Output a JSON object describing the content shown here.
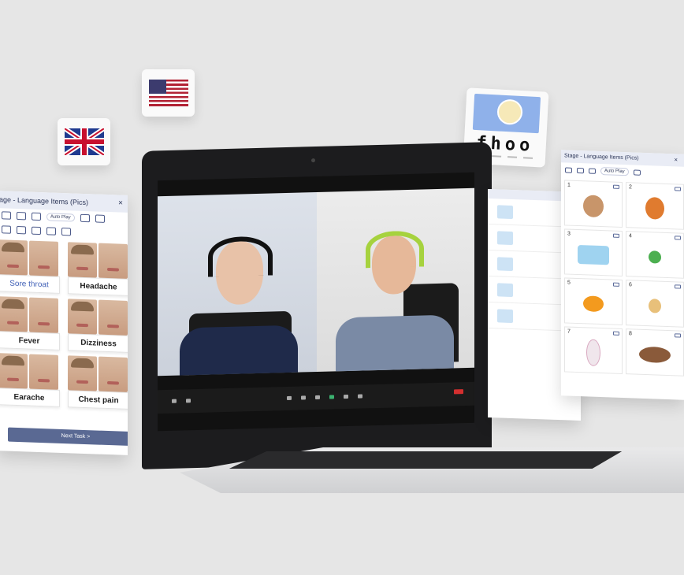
{
  "fhoo_card": {
    "word": "fhoo"
  },
  "left_panel": {
    "title": "age - Language Items (Pics)",
    "autoplay_label": "Auto Play",
    "items": [
      {
        "label": "Sore throat",
        "active": true
      },
      {
        "label": "Headache",
        "active": false
      },
      {
        "label": "Fever",
        "active": false
      },
      {
        "label": "Dizziness",
        "active": false
      },
      {
        "label": "Earache",
        "active": false
      },
      {
        "label": "Chest pain",
        "active": false
      }
    ],
    "next_button": "Next Task  >"
  },
  "right_panel": {
    "title": "Stage - Language Items (Pics)",
    "autoplay_label": "Auto Play",
    "cells": [
      "1",
      "2",
      "3",
      "4",
      "5",
      "6",
      "7",
      "8"
    ]
  },
  "colors": {
    "accent": "#5a6993",
    "active_text": "#4463b8",
    "end_button": "#d32f2f"
  }
}
